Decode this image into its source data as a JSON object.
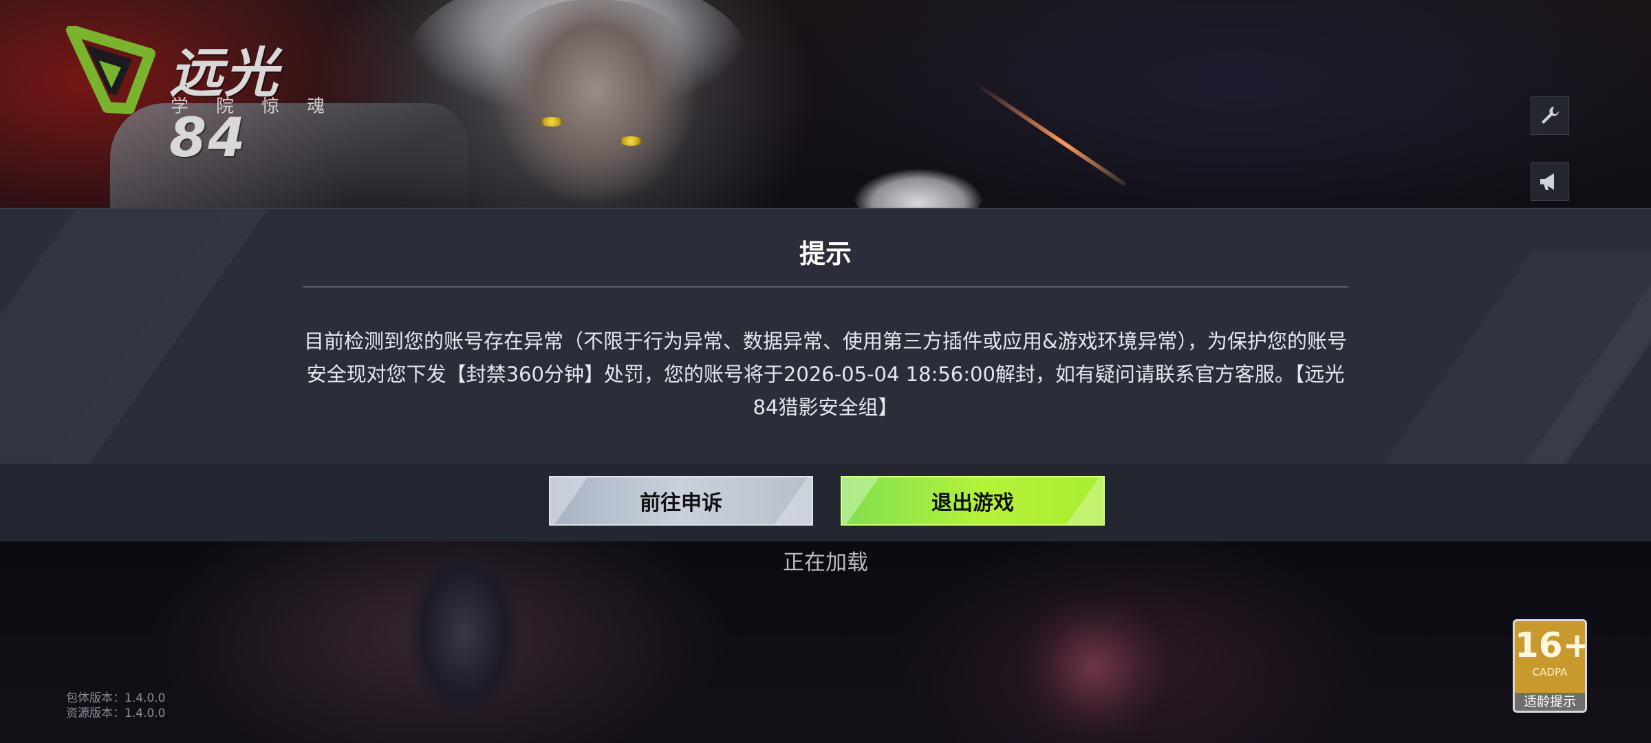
{
  "logo": {
    "title": "远光84",
    "subtitle": "学院惊魂",
    "mark_color": "#7ab32e"
  },
  "side_buttons": [
    {
      "icon": "wrench-icon"
    },
    {
      "icon": "megaphone-icon"
    }
  ],
  "dialog": {
    "title": "提示",
    "message": "目前检测到您的账号存在异常（不限于行为异常、数据异常、使用第三方插件或应用&游戏环境异常），为保护您的账号安全现对您下发【封禁360分钟】处罚，您的账号将于2026-05-04 18:56:00解封，如有疑问请联系官方客服。【远光84猎影安全组】",
    "buttons": {
      "appeal": "前往申诉",
      "exit": "退出游戏"
    }
  },
  "status": {
    "loading": "正在加载"
  },
  "version": {
    "package": "包体版本：1.4.0.0",
    "resource": "资源版本：1.4.0.0"
  },
  "age_rating": {
    "age": "16+",
    "org": "CADPA",
    "label": "适龄提示"
  },
  "colors": {
    "exit_button": "#b6f23a",
    "appeal_button": "#c9d1dc",
    "dialog_bg": "#2b2e3a"
  }
}
